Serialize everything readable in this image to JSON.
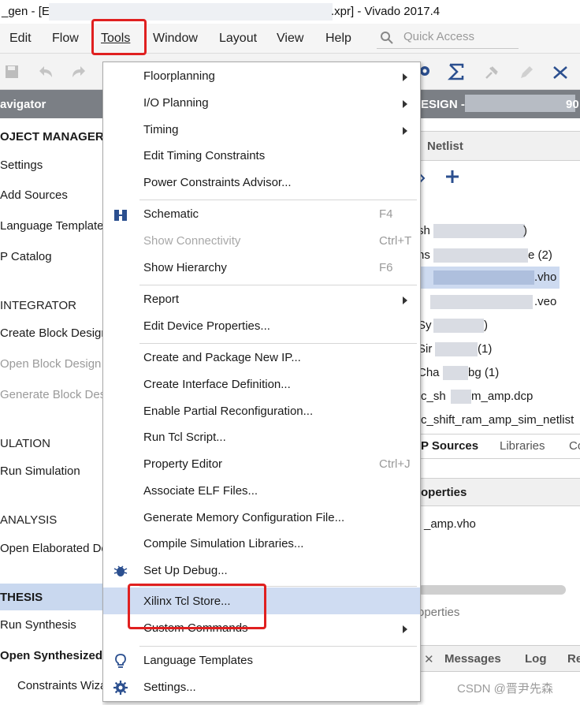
{
  "window": {
    "title_left": "_gen - [E:/",
    "title_right": ".xpr] - Vivado 2017.4"
  },
  "menubar": {
    "items": [
      "Edit",
      "Flow",
      "Tools",
      "Window",
      "Layout",
      "View",
      "Help"
    ],
    "quick_access_placeholder": "Quick Access"
  },
  "navigator": {
    "header": "avigator",
    "entries": [
      {
        "label": "OJECT MANAGER",
        "kind": "section-bold"
      },
      {
        "label": "Settings"
      },
      {
        "label": "Add Sources"
      },
      {
        "label": "Language Templates"
      },
      {
        "label": "P Catalog"
      },
      {
        "label": "INTEGRATOR",
        "kind": "section"
      },
      {
        "label": "Create Block Design"
      },
      {
        "label": "Open Block Design",
        "kind": "disabled"
      },
      {
        "label": "Generate Block Design",
        "kind": "disabled"
      },
      {
        "label": "ULATION",
        "kind": "section"
      },
      {
        "label": "Run Simulation"
      },
      {
        "label": "ANALYSIS",
        "kind": "section"
      },
      {
        "label": "Open Elaborated Design"
      },
      {
        "label": "THESIS",
        "kind": "section-bold"
      },
      {
        "label": "Run Synthesis"
      },
      {
        "label": "Open Synthesized Design",
        "kind": "bold"
      },
      {
        "label": "Constraints Wizard"
      }
    ]
  },
  "tools_menu": {
    "items": [
      {
        "label": "Floorplanning",
        "submenu": true
      },
      {
        "label": "I/O Planning",
        "submenu": true
      },
      {
        "label": "Timing",
        "submenu": true
      },
      {
        "label": "Edit Timing Constraints"
      },
      {
        "label": "Power Constraints Advisor..."
      },
      {
        "label": "Schematic",
        "shortcut": "F4",
        "icon": "schematic-icon"
      },
      {
        "label": "Show Connectivity",
        "shortcut": "Ctrl+T",
        "disabled": true
      },
      {
        "label": "Show Hierarchy",
        "shortcut": "F6"
      },
      {
        "label": "Report",
        "submenu": true
      },
      {
        "label": "Edit Device Properties..."
      },
      {
        "label": "Create and Package New IP..."
      },
      {
        "label": "Create Interface Definition..."
      },
      {
        "label": "Enable Partial Reconfiguration..."
      },
      {
        "label": "Run Tcl Script..."
      },
      {
        "label": "Property Editor",
        "shortcut": "Ctrl+J"
      },
      {
        "label": "Associate ELF Files..."
      },
      {
        "label": "Generate Memory Configuration File..."
      },
      {
        "label": "Compile Simulation Libraries..."
      },
      {
        "label": "Set Up Debug...",
        "icon": "bug-icon"
      },
      {
        "label": "Xilinx Tcl Store...",
        "highlighted": true
      },
      {
        "label": "Custom Commands",
        "submenu": true
      },
      {
        "label": "Language Templates",
        "icon": "lightbulb-icon"
      },
      {
        "label": "Settings...",
        "icon": "gear-icon"
      }
    ]
  },
  "right_panel": {
    "design_header": "ESIGN - s",
    "design_header_suffix": "90",
    "netlist_tab": "Netlist",
    "tree_items": [
      "sh",
      ")",
      "ns",
      "e (2)",
      ".vho",
      ".veo",
      "Sy",
      ")",
      "Sir",
      "(1)",
      "Cha",
      "bg (1)",
      "c_sh",
      "m_amp.dcp",
      "c_shift_ram_amp_sim_netlist"
    ],
    "tabs": [
      "P Sources",
      "Libraries",
      "Co"
    ],
    "properties_header": "operties",
    "properties_value": "_amp.vho",
    "properties_footer": "operties",
    "bottom_tabs": [
      "Messages",
      "Log",
      "Re"
    ]
  },
  "watermark": "CSDN @晋尹先森"
}
